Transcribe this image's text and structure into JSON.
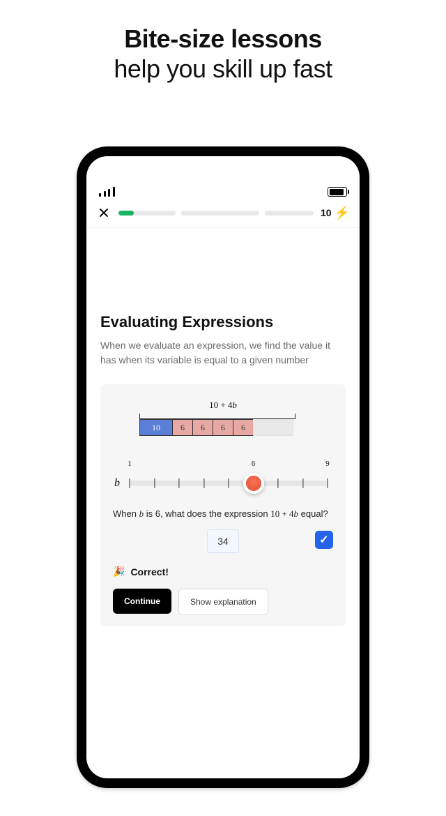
{
  "headline": {
    "bold": "Bite-size lessons",
    "regular": "help you skill up fast"
  },
  "appbar": {
    "streak_count": "10"
  },
  "lesson": {
    "title": "Evaluating Expressions",
    "description": "When we evaluate an expression, we find the value it has when its variable is equal to a given number"
  },
  "diagram": {
    "top_label": "10 + 4b",
    "boxes": [
      "10",
      "6",
      "6",
      "6",
      "6"
    ]
  },
  "slider": {
    "var": "b",
    "labels": {
      "start": "1",
      "mid": "6",
      "end": "9"
    },
    "ticks": 9,
    "value_index": 6
  },
  "question": {
    "prefix": "When ",
    "var": "b",
    "mid": " is ",
    "val": "6",
    "mid2": ", what does the expression ",
    "expr": "10 + 4b",
    "suffix": " equal?"
  },
  "answer": {
    "value": "34"
  },
  "feedback": {
    "emoji": "🎉",
    "text": "Correct!"
  },
  "buttons": {
    "continue": "Continue",
    "explain": "Show explanation"
  },
  "chart_data": {
    "type": "bar",
    "categories": [
      "10",
      "b",
      "b",
      "b",
      "b"
    ],
    "values": [
      10,
      6,
      6,
      6,
      6
    ],
    "title": "10 + 4b",
    "b_value": 6,
    "b_range": [
      1,
      9
    ],
    "total": 34
  }
}
